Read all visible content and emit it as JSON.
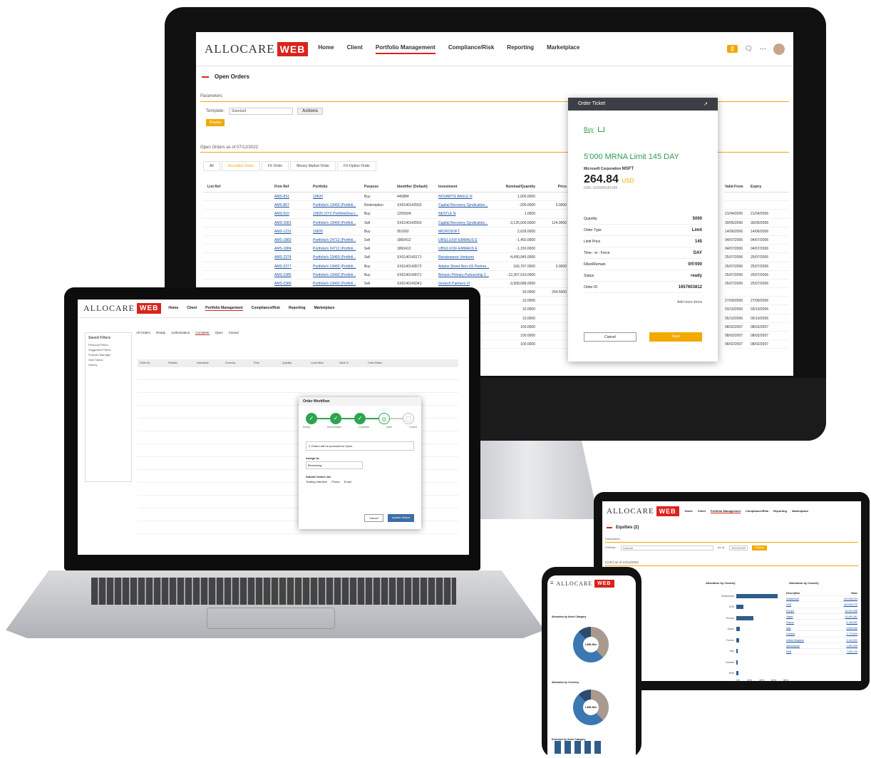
{
  "desktop": {
    "logo": {
      "text": "ALLOCARE",
      "badge": "WEB"
    },
    "nav": [
      "Home",
      "Client",
      "Portfolio Management",
      "Compliance/Risk",
      "Reporting",
      "Marketplace"
    ],
    "notification_count": "2",
    "page_title": "Open Orders",
    "parameters_label": "Parameters",
    "template_label": "Template:",
    "template_value": "Standard",
    "actions_label": "Actions",
    "display_label": "Display",
    "orders_heading": "Open Orders as of 07/12/2022",
    "tabs": [
      "All",
      "Securities Order",
      "FX Order",
      "Money Market Order",
      "FX-Option Order"
    ],
    "columns": [
      "List Ref",
      "Firm Ref",
      "Portfolio",
      "Purpose",
      "Identifier (Default)",
      "Investment",
      "Nominal/Quantity",
      "Price"
    ],
    "rows": [
      [
        "",
        "AMS-831",
        "10820",
        "Buy",
        "445884",
        "NOVARTIS BASLE N",
        "1,000.0000",
        ""
      ],
      [
        "",
        "AMS-857",
        "Portfolio/v 13460 (Portfoli...",
        "Redemption",
        "XX0140142503",
        "Capital Recovery Syndication...",
        "-200.0000",
        "5.0000"
      ],
      [
        "",
        "AMS-910",
        "10820 (XYZ PortfolioDescr...",
        "Buy",
        "1205604",
        "NESTLE N",
        "1.0000",
        ""
      ],
      [
        "",
        "AMS-1081",
        "Portfolio/v 13460 (Portfoli...",
        "Sell",
        "XX0140142503",
        "Capital Recovery Syndication...",
        "-3,125,000.0000",
        "124.0000"
      ],
      [
        "",
        "AMS-1231",
        "10820",
        "Buy",
        "951692",
        "MICROSOFT",
        "2,628.0000",
        ""
      ],
      [
        "",
        "AMS-1883",
        "Portfolio/v 24712 (Portfoli...",
        "Sell",
        "1860412",
        "UBS(LUX)F-EMMAUS E",
        "-1,450.0000",
        ""
      ],
      [
        "",
        "AMS-1884",
        "Portfolio/v 24712 (Portfoli...",
        "Sell",
        "1860412",
        "UBS(LUX)F-EMMAUS E",
        "-1,150.0000",
        ""
      ],
      [
        "",
        "AMS-2374",
        "Portfolio/v 13460 (Portfoli...",
        "Sell",
        "XX0140143171",
        "Renaissance Ventures",
        "-4,490,945.0000",
        ""
      ],
      [
        "",
        "AMS-2377",
        "Portfolio/v 13460 (Portfoli...",
        "Buy",
        "XX0140143572",
        "Adams Street Non-US Partner...",
        "166,707.0000",
        "0.0000"
      ],
      [
        "",
        "AMS-2385",
        "Portfolio/v 13460 (Portfoli...",
        "Buy",
        "XX0140143071",
        "Brinson Primary Partnership 2...",
        "-12,307,910.0000",
        ""
      ],
      [
        "",
        "AMS-2389",
        "Portfolio/v 13460 (Portfoli...",
        "Sell",
        "XX0140143341",
        "Grotech Partners VI",
        "-3,958,688.0000",
        ""
      ],
      [
        "AMS CO-2462",
        "AMS CO-2462",
        "",
        "Buy",
        "1205604",
        "NESTLE N",
        "30.0000",
        "204.5000"
      ],
      [
        "",
        "",
        "",
        "",
        "",
        "",
        "10.0000",
        ""
      ],
      [
        "",
        "",
        "",
        "",
        "",
        "",
        "10.0000",
        ""
      ],
      [
        "",
        "",
        "",
        "",
        "",
        "",
        "10.0000",
        ""
      ],
      [
        "",
        "",
        "",
        "",
        "",
        "",
        "100.0000",
        ""
      ],
      [
        "",
        "",
        "",
        "",
        "",
        "",
        "100.0000",
        ""
      ],
      [
        "",
        "",
        "",
        "",
        "",
        "",
        "100.0000",
        ""
      ]
    ],
    "right_columns": [
      "Valid From",
      "Expiry"
    ],
    "right_rows": [
      [
        "",
        ""
      ],
      [
        "",
        ""
      ],
      [
        "21/04/2006",
        "21/04/2006"
      ],
      [
        "30/05/2006",
        "30/05/2006"
      ],
      [
        "14/06/2006",
        "14/06/2006"
      ],
      [
        "04/07/2006",
        "04/07/2006"
      ],
      [
        "04/07/2006",
        "04/07/2006"
      ],
      [
        "25/07/2006",
        "25/07/2006"
      ],
      [
        "25/07/2006",
        "25/07/2006"
      ],
      [
        "25/07/2006",
        "25/07/2006"
      ],
      [
        "25/07/2006",
        "25/07/2006"
      ],
      [
        "",
        ""
      ],
      [
        "27/09/2006",
        "27/09/2006"
      ],
      [
        "03/10/2006",
        "03/10/2006"
      ],
      [
        "05/10/2006",
        "05/10/2006"
      ],
      [
        "08/02/2007",
        "08/02/2007"
      ],
      [
        "08/02/2007",
        "08/02/2007"
      ],
      [
        "08/02/2007",
        "08/02/2007"
      ]
    ]
  },
  "ticket": {
    "title": "Order Ticket",
    "buy_label": "Buy",
    "headline": "5'000 MRNA Limit 145 DAY",
    "corp_label": "Microsoft Corporation",
    "ticker": "MSFT",
    "price": "264.84",
    "currency": "USD",
    "isin": "ISIN: US5949181045",
    "fields": [
      {
        "label": "Quantity",
        "value": "5000"
      },
      {
        "label": "Order Type",
        "value": "Limit"
      },
      {
        "label": "Limit Price",
        "value": "145"
      },
      {
        "label": "Time - in - Force",
        "value": "DAY"
      },
      {
        "label": "Filled/Remain",
        "value": "0/5'000"
      },
      {
        "label": "Status",
        "value": "ready"
      },
      {
        "label": "Order ID",
        "value": "1657603812"
      }
    ],
    "add_more": "Add more items",
    "cancel": "Cancel",
    "save": "Save"
  },
  "laptop": {
    "nav": [
      "Home",
      "Client",
      "Portfolio Management",
      "Compliance/Risk",
      "Reporting",
      "Marketplace"
    ],
    "saved_filters": "Saved Filters",
    "filters": [
      "Personal Filters",
      "Suggested Filters",
      "Portfolio Manager",
      "Side Status",
      "History"
    ],
    "status_tabs": [
      "All Orders",
      "Ready",
      "Authorisation",
      "Complete",
      "Open",
      "Closed"
    ],
    "table_headers": [
      "Order No",
      "Portfolio",
      "Instrument",
      "Currency",
      "Price",
      "Quantity",
      "Local Value",
      "Value %",
      "Order Status"
    ],
    "workflow_title": "Order Workflow",
    "workflow_steps": [
      "Ready",
      "Authorisation",
      "Complete",
      "Open",
      "Closed"
    ],
    "promote_note": "2 Orders will be promoted to Open.",
    "assign_label": "Assign to:",
    "assign_value": "Bloomberg",
    "submit_label": "Submit Orders via:",
    "submit_options": [
      "Trading Interface",
      "Phone",
      "Email"
    ],
    "cancel": "Cancel",
    "update": "Update Status"
  },
  "tablet": {
    "nav": [
      "Home",
      "Client",
      "Portfolio Management",
      "Compliance/Risk",
      "Reporting",
      "Marketplace"
    ],
    "page_title": "Equities (2)",
    "parameters_label": "Parameters",
    "portfolio_label": "Portfolio:",
    "portfolio_value": "Lucerne",
    "asof_label": "As of:",
    "asof_value": "13/12/2022",
    "display_label": "Display",
    "heading": "(CHF) as of 13/12/2022",
    "chart_title": "Allocation by Country",
    "table_title": "Allocation by Country",
    "table_cols": [
      "Description",
      "Value"
    ],
    "countries": [
      {
        "name": "Switzerland",
        "value": "102,005,034"
      },
      {
        "name": "USA",
        "value": "140,939,270"
      },
      {
        "name": "Europe",
        "value": "32,993,458"
      },
      {
        "name": "Japan",
        "value": "19,490,361"
      },
      {
        "name": "France",
        "value": "6,749,931"
      },
      {
        "name": "Italy",
        "value": "3,509,430"
      },
      {
        "name": "Canada",
        "value": "2,773,609"
      },
      {
        "name": "United Kingdom",
        "value": "2,124,322"
      },
      {
        "name": "Netherlands",
        "value": "1,899,595"
      },
      {
        "name": "Rest",
        "value": "7,634,110"
      }
    ],
    "bar_countries": [
      "Switzerland",
      "USA",
      "Europe",
      "Japan",
      "France",
      "Italy",
      "Canada",
      "Rest"
    ],
    "bar_levels": [
      0.72,
      0.12,
      0.3,
      0.06,
      0.05,
      0.03,
      0.02,
      0.04
    ],
    "axis_ticks": [
      "0%",
      "20%",
      "40%",
      "60%",
      "80%"
    ]
  },
  "phone": {
    "card1_title": "Allocation by Asset Category",
    "card1_center": "1,888.38m",
    "card2_title": "Allocation by Currency",
    "card2_center": "1,888.38m",
    "card3_title": "Evolution by Asset Category"
  },
  "colors": {
    "brand_red": "#d9241b",
    "accent_orange": "#f2a900",
    "buy_green": "#2e9b4f"
  }
}
